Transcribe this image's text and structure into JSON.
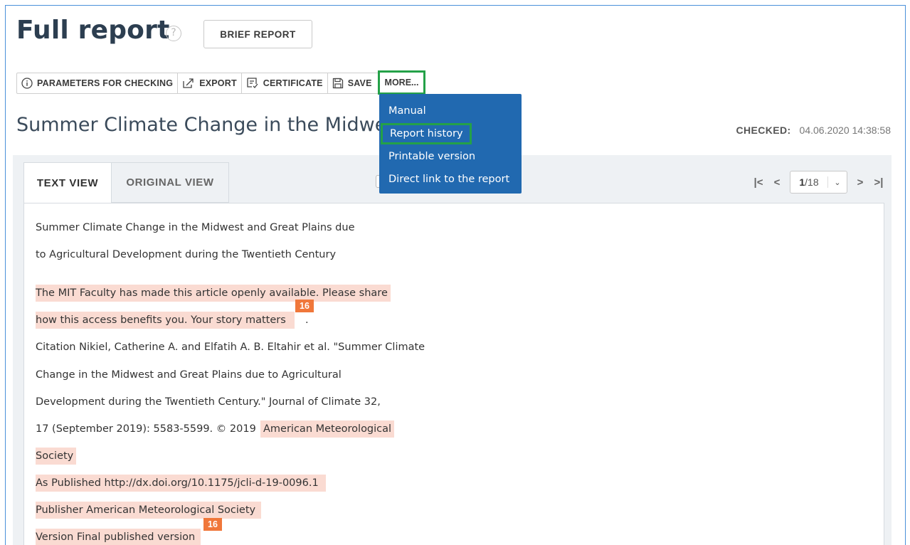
{
  "header": {
    "title": "Full report",
    "help_glyph": "?",
    "brief_report_label": "BRIEF REPORT"
  },
  "toolbar": {
    "parameters_label": "PARAMETERS FOR CHECKING",
    "export_label": "EXPORT",
    "certificate_label": "CERTIFICATE",
    "save_label": "SAVE",
    "more_label": "MORE..."
  },
  "more_menu": {
    "items": [
      {
        "label": "Manual"
      },
      {
        "label": "Report history"
      },
      {
        "label": "Printable version"
      },
      {
        "label": "Direct link to the report"
      }
    ]
  },
  "document": {
    "title": "Summer Climate Change in the Midwest",
    "checked_label": "CHECKED:",
    "checked_value": "04.06.2020 14:38:58"
  },
  "tabs": {
    "text_view": "TEXT VIEW",
    "original_view": "ORIGINAL VIEW"
  },
  "pager": {
    "current": "1",
    "total": "/18"
  },
  "content": {
    "lines": [
      "Summer Climate Change in the Midwest and Great Plains due",
      "to Agricultural Development during the Twentieth Century",
      "The MIT Faculty has made this article openly available. Please share",
      "how this access benefits you. Your story matters",
      ".",
      "Citation Nikiel, Catherine A. and Elfatih A. B. Eltahir et al. \"Summer Climate",
      "Change in the Midwest and Great Plains due to Agricultural",
      "Development during the Twentieth Century.\" Journal of Climate 32,",
      "17 (September 2019): 5583-5599. © 2019",
      "American Meteorological",
      "Society",
      "As Published http://dx.doi.org/10.1175/jcli-d-19-0096.1",
      "Publisher American Meteorological Society",
      "Version Final published version"
    ],
    "badges": [
      "16",
      "16"
    ]
  },
  "colors": {
    "accent_blue": "#2169b0",
    "highlight_green": "#24a148",
    "match_highlight": "#fadbd2",
    "badge_orange": "#f0773a"
  }
}
